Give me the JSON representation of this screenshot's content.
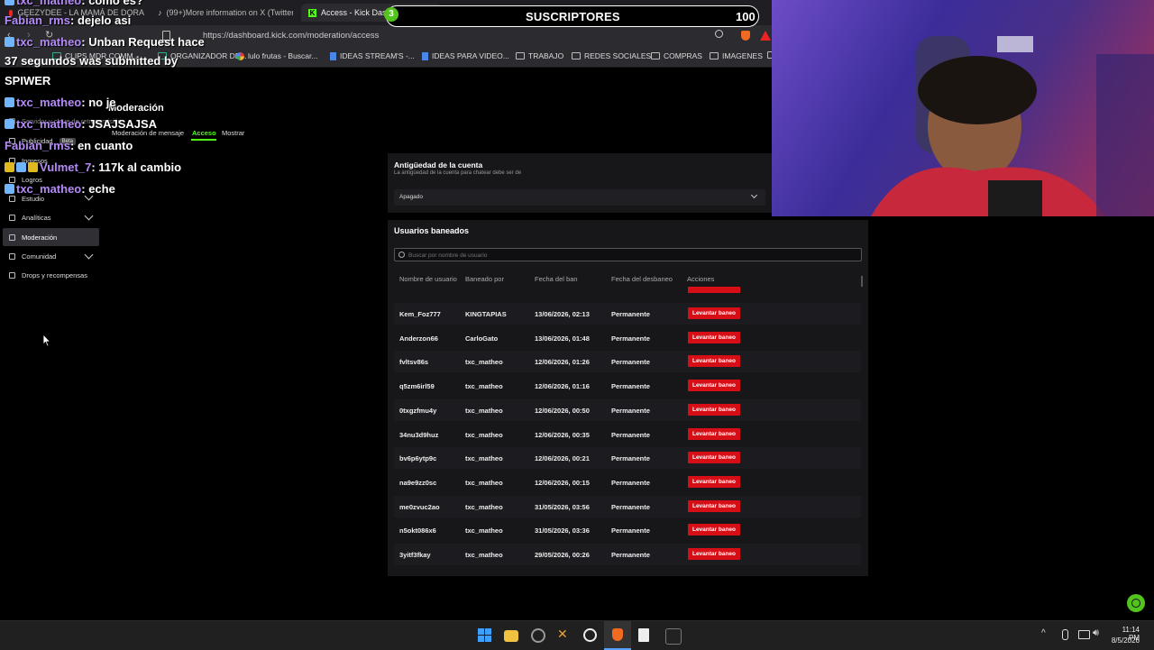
{
  "browser": {
    "tabs": [
      {
        "label": "GEEZYDEE - LA MAMÁ DE DORA"
      },
      {
        "label": "(99+)More information on X (Twitter)"
      },
      {
        "label": "Access - Kick Dashb"
      }
    ],
    "url": "https://dashboard.kick.com/moderation/access",
    "bookmarks": [
      "CLIPS MDR COMM...",
      "ORGANIZADOR DE...",
      "lulo frutas - Buscar...",
      "IDEAS STREAM'S -...",
      "IDEAS PARA VIDEO...",
      "TRABAJO",
      "REDES SOCIALES",
      "COMPRAS",
      "IMAGENES"
    ]
  },
  "overlay": {
    "sub_goal_label": "SUSCRIPTORES",
    "sub_goal_count": "100",
    "sub_badge": "3",
    "chat": [
      {
        "user": "txc_matheo",
        "msg": "como es?"
      },
      {
        "user": "Fabian_rms",
        "msg": "dejelo asi"
      },
      {
        "user": "txc_matheo",
        "msg": "Unban Request hace"
      },
      {
        "user": "",
        "msg": "37 segundos was submitted by"
      },
      {
        "user": "",
        "msg": "SPIWER"
      },
      {
        "user": "txc_matheo",
        "msg": "no je"
      },
      {
        "user": "txc_matheo",
        "msg": "JSAJSAJSA"
      },
      {
        "user": "Fabian_rms",
        "msg": "en cuanto"
      },
      {
        "user": "Vulmet_7",
        "msg": "117k al cambio"
      },
      {
        "user": "txc_matheo",
        "msg": "eche"
      }
    ]
  },
  "sidebar": {
    "items": [
      {
        "label": "Servidor y clave de retransmisión"
      },
      {
        "label": "Publicidad",
        "badge": "Beta"
      },
      {
        "label": "Ingresos"
      },
      {
        "label": "Logros"
      },
      {
        "label": "Estudio"
      },
      {
        "label": "Analíticas"
      },
      {
        "label": "Moderación"
      },
      {
        "label": "Comunidad"
      },
      {
        "label": "Drops y recompensas"
      }
    ]
  },
  "page": {
    "title": "Moderación",
    "tabs": [
      "Moderación de mensaje",
      "Acceso",
      "Mostrar"
    ]
  },
  "account_age": {
    "title": "Antigüedad de la cuenta",
    "desc": "La antigüedad de la cuenta para chatear debe ser de",
    "value": "Apagado"
  },
  "bans": {
    "title": "Usuarios baneados",
    "search_placeholder": "Buscar por nombre de usuario",
    "columns": [
      "Nombre de usuario",
      "Baneado por",
      "Fecha del ban",
      "Fecha del desbaneo",
      "Acciones"
    ],
    "rows": [
      {
        "user": "Kem_Foz777",
        "by": "KINGTAPIAS",
        "date": "13/06/2026, 02:13",
        "unban": "Permanente",
        "action": "Levantar baneo"
      },
      {
        "user": "Anderzon66",
        "by": "CarloGato",
        "date": "13/06/2026, 01:48",
        "unban": "Permanente",
        "action": "Levantar baneo"
      },
      {
        "user": "fvltsv86s",
        "by": "txc_matheo",
        "date": "12/06/2026, 01:26",
        "unban": "Permanente",
        "action": "Levantar baneo"
      },
      {
        "user": "q5zm6irl59",
        "by": "txc_matheo",
        "date": "12/06/2026, 01:16",
        "unban": "Permanente",
        "action": "Levantar baneo"
      },
      {
        "user": "0txgzfmu4y",
        "by": "txc_matheo",
        "date": "12/06/2026, 00:50",
        "unban": "Permanente",
        "action": "Levantar baneo"
      },
      {
        "user": "34nu3d9huz",
        "by": "txc_matheo",
        "date": "12/06/2026, 00:35",
        "unban": "Permanente",
        "action": "Levantar baneo"
      },
      {
        "user": "bv6p6ytp9c",
        "by": "txc_matheo",
        "date": "12/06/2026, 00:21",
        "unban": "Permanente",
        "action": "Levantar baneo"
      },
      {
        "user": "na9e9zz0sc",
        "by": "txc_matheo",
        "date": "12/06/2026, 00:15",
        "unban": "Permanente",
        "action": "Levantar baneo"
      },
      {
        "user": "me0zvuc2ao",
        "by": "txc_matheo",
        "date": "31/05/2026, 03:56",
        "unban": "Permanente",
        "action": "Levantar baneo"
      },
      {
        "user": "n5okt086x6",
        "by": "txc_matheo",
        "date": "31/05/2026, 03:36",
        "unban": "Permanente",
        "action": "Levantar baneo"
      },
      {
        "user": "3yitf3fkay",
        "by": "txc_matheo",
        "date": "29/05/2026, 00:26",
        "unban": "Permanente",
        "action": "Levantar baneo"
      }
    ]
  },
  "taskbar": {
    "time": "11:14 PM",
    "date": "8/5/2026"
  },
  "colors": {
    "accent": "#53fc18",
    "danger": "#d60f17",
    "chat_user": "#b48af6"
  }
}
